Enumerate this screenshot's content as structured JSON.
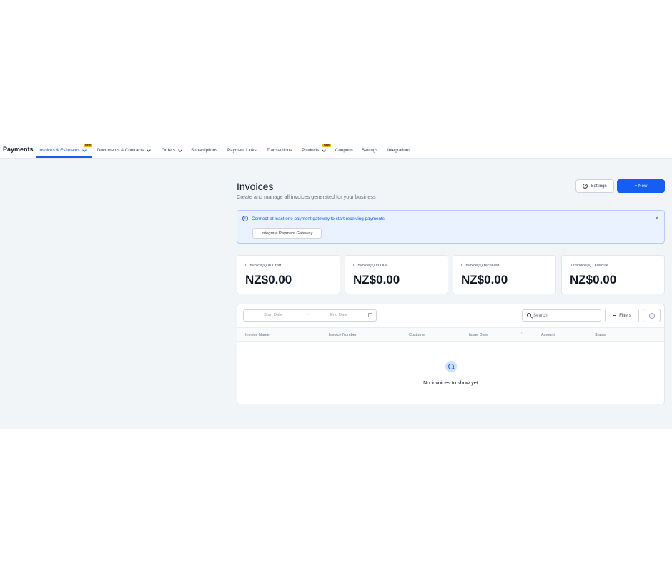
{
  "nav": {
    "brand": "Payments",
    "items": [
      {
        "label": "Invoices & Estimates",
        "badge": "New",
        "dropdown": true,
        "active": true
      },
      {
        "label": "Documents & Contracts",
        "dropdown": true
      },
      {
        "label": "Orders",
        "dropdown": true
      },
      {
        "label": "Subscriptions"
      },
      {
        "label": "Payment Links"
      },
      {
        "label": "Transactions"
      },
      {
        "label": "Products",
        "badge": "New",
        "dropdown": true
      },
      {
        "label": "Coupons"
      },
      {
        "label": "Settings"
      },
      {
        "label": "Integrations"
      }
    ]
  },
  "header": {
    "title": "Invoices",
    "subtitle": "Create and manage all invoices generated for your business",
    "settings_label": "Settings",
    "new_label": "+ New"
  },
  "alert": {
    "message": "Connect at least one payment gateway to start receiving payments",
    "close": "×",
    "button_label": "Integrate Payment Gateway"
  },
  "cards": [
    {
      "label": "0 Invoice(s) in Draft",
      "value": "NZ$0.00"
    },
    {
      "label": "0 Invoice(s) in Due",
      "value": "NZ$0.00"
    },
    {
      "label": "0 Invoice(s) received",
      "value": "NZ$0.00"
    },
    {
      "label": "0 Invoice(s) Overdue",
      "value": "NZ$0.00"
    }
  ],
  "table": {
    "start_date_placeholder": "Start Date",
    "end_date_placeholder": "End Date",
    "search_placeholder": "Search",
    "filters_label": "Filters",
    "columns": [
      "Invoice Name",
      "Invoice Number",
      "Customer",
      "Issue Date",
      "Amount",
      "Status"
    ],
    "empty_message": "No invoices to show yet"
  },
  "colors": {
    "accent": "#155eef",
    "badge": "#fdb022",
    "background": "#f1f5f8"
  }
}
